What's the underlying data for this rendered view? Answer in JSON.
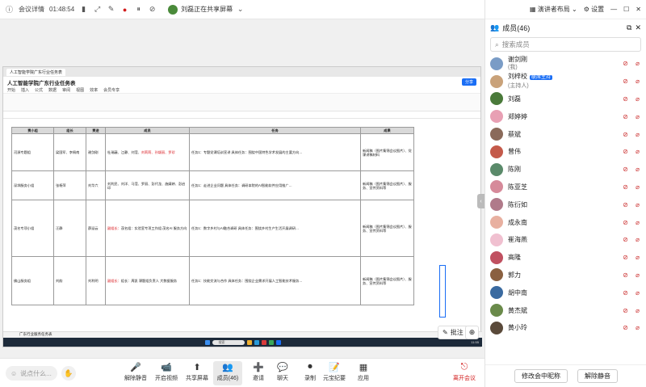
{
  "topbar": {
    "meeting_info": "会议详情",
    "time": "01:48:54",
    "sharer": "刘磊正在共享屏幕"
  },
  "panel": {
    "layout": "演讲者布局",
    "settings": "设置",
    "members_title": "成员(46)",
    "search_placeholder": "搜索成员",
    "host_badge": "联席主持",
    "members": [
      {
        "name": "谢剑刚",
        "sub": "(我)",
        "color": "#7a9cc6"
      },
      {
        "name": "刘梓校",
        "sub": "(主持人)",
        "color": "#c9a27a",
        "badge": true
      },
      {
        "name": "刘磊",
        "sub": "",
        "color": "#4a7a3a"
      },
      {
        "name": "郑婷婷",
        "sub": "",
        "color": "#e8a0b4"
      },
      {
        "name": "蔡斌",
        "sub": "",
        "color": "#8a6a5a"
      },
      {
        "name": "曾伟",
        "sub": "",
        "color": "#c45a4a"
      },
      {
        "name": "陈刚",
        "sub": "",
        "color": "#5a8a6a"
      },
      {
        "name": "陈亚芝",
        "sub": "",
        "color": "#d68a9a"
      },
      {
        "name": "陈衍如",
        "sub": "",
        "color": "#b07a8a"
      },
      {
        "name": "成永南",
        "sub": "",
        "color": "#e8b0a0"
      },
      {
        "name": "崔海燕",
        "sub": "",
        "color": "#f0c0d0"
      },
      {
        "name": "高隆",
        "sub": "",
        "color": "#c05060"
      },
      {
        "name": "郭力",
        "sub": "",
        "color": "#8a6040"
      },
      {
        "name": "胡中南",
        "sub": "",
        "color": "#3a6aa0"
      },
      {
        "name": "黄杰斌",
        "sub": "",
        "color": "#6a8a4a"
      },
      {
        "name": "黄小玲",
        "sub": "",
        "color": "#5a4a3a"
      }
    ],
    "footer": {
      "rename": "修改会中昵称",
      "mute_all": "解除静音"
    }
  },
  "shared": {
    "tab": "人工智能学院广东行业任务表",
    "doc_title": "人工智能学院广东行业任务表",
    "menus": [
      "开始",
      "插入",
      "公式",
      "数据",
      "审阅",
      "视图",
      "效率",
      "会员专享"
    ],
    "share_button": "分享",
    "headers": [
      "责小组",
      "组长",
      "责进",
      "成员",
      "任务",
      "成果"
    ],
    "rows": [
      {
        "num": "1",
        "group": "河源专题组",
        "leader": "梁国军、李佩南",
        "owner": "谢剑刚",
        "members": "杜瑞巍、江静、刘滢、",
        "members_red": "刘莉莉、孙颖丽、罗珍",
        "task": "任务1：专题党课培训宣讲 具体任务：围绕中国特色学术发展的主要方向…",
        "result": "新闻稿（图片集锦会议图片）、党课讲稿材料"
      },
      {
        "num": "2",
        "group": "深圳服务小组",
        "leader": "张杨萍",
        "owner": "刘华六",
        "members": "刘利民、刘洋、马滢、罗丽、彭代龙、施婧婷、彭启印",
        "members_red": "",
        "task": "任务1：走进企业问题 具体任务：调研本院的AI智能软件应用推广…",
        "result": "新闻稿（图片集锦会议图片）、服务、宣传资料等"
      },
      {
        "num": "3",
        "group": "茂名专项小组",
        "leader": "汪静",
        "owner": "薛延云",
        "members": "茂名组：实验室专项工作组 茂名AI 服务方向",
        "members_red": "副组长：",
        "task": "任务1：数字乡村与AI融合调研 具体任务：围绕乡村生产生活开展调研…",
        "result": "新闻稿（图片集锦会议图片）、服务、宣传资料等"
      },
      {
        "num": "4",
        "group": "佛山服务组",
        "leader": "刘韵",
        "owner": "刘利明",
        "members": "组长：周凯 课题组负责人 大数据服务",
        "members_red": "副组长：",
        "task": "任务1：技能交流与合作 具体任务：围绕企业需求开展人工智能技术服务…",
        "result": "新闻稿（图片集锦会议图片）、服务、宣传资料等"
      }
    ],
    "sheet_tab": "广东行业服务任务表",
    "taskbar_search": "搜索",
    "taskbar_time": "11:55"
  },
  "comment_label": "批注",
  "bottom": {
    "say_placeholder": "说点什么...",
    "tools": [
      {
        "label": "解除静音",
        "icon": "🎤"
      },
      {
        "label": "开启视频",
        "icon": "📹"
      },
      {
        "label": "共享屏幕",
        "icon": "⬆"
      },
      {
        "label": "成员(46)",
        "icon": "👥"
      },
      {
        "label": "邀请",
        "icon": "➕"
      },
      {
        "label": "聊天",
        "icon": "💬"
      },
      {
        "label": "录制",
        "icon": "⏺"
      },
      {
        "label": "元宝纪要",
        "icon": "📝"
      },
      {
        "label": "应用",
        "icon": "▦"
      }
    ],
    "end": "离开会议"
  }
}
